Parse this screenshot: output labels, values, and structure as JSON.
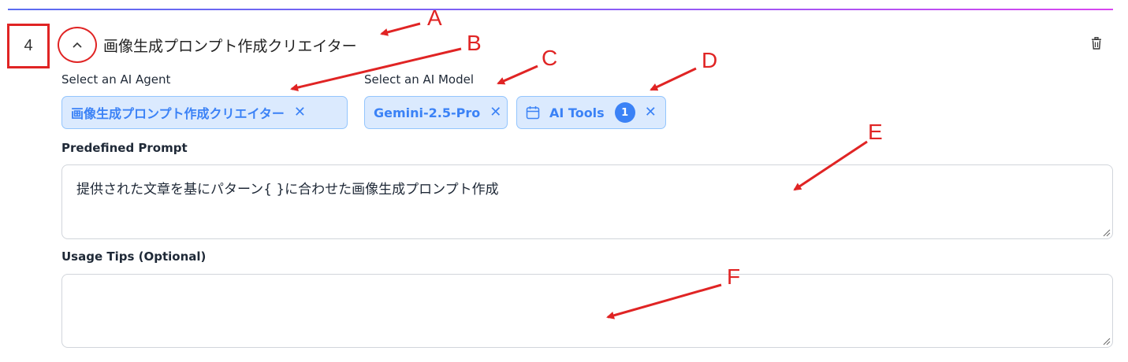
{
  "step": {
    "number": "4"
  },
  "header": {
    "title": "画像生成プロンプト作成クリエイター"
  },
  "agent": {
    "label": "Select an AI Agent",
    "selected": "画像生成プロンプト作成クリエイター",
    "remove": "✕"
  },
  "model": {
    "label": "Select an AI Model",
    "selected": "Gemini-2.5-Pro",
    "remove": "✕"
  },
  "tools": {
    "label": "AI Tools",
    "count": "1",
    "remove": "✕",
    "icon": "calendar-icon"
  },
  "prompt": {
    "label": "Predefined Prompt",
    "value": "提供された文章を基にパターン{ }に合わせた画像生成プロンプト作成"
  },
  "tips": {
    "label": "Usage Tips (Optional)",
    "value": ""
  },
  "annotations": [
    "A",
    "B",
    "C",
    "D",
    "E",
    "F"
  ],
  "colors": {
    "accent": "#3b82f6",
    "chip_bg": "#dbeafe",
    "annotation": "#e02424"
  }
}
